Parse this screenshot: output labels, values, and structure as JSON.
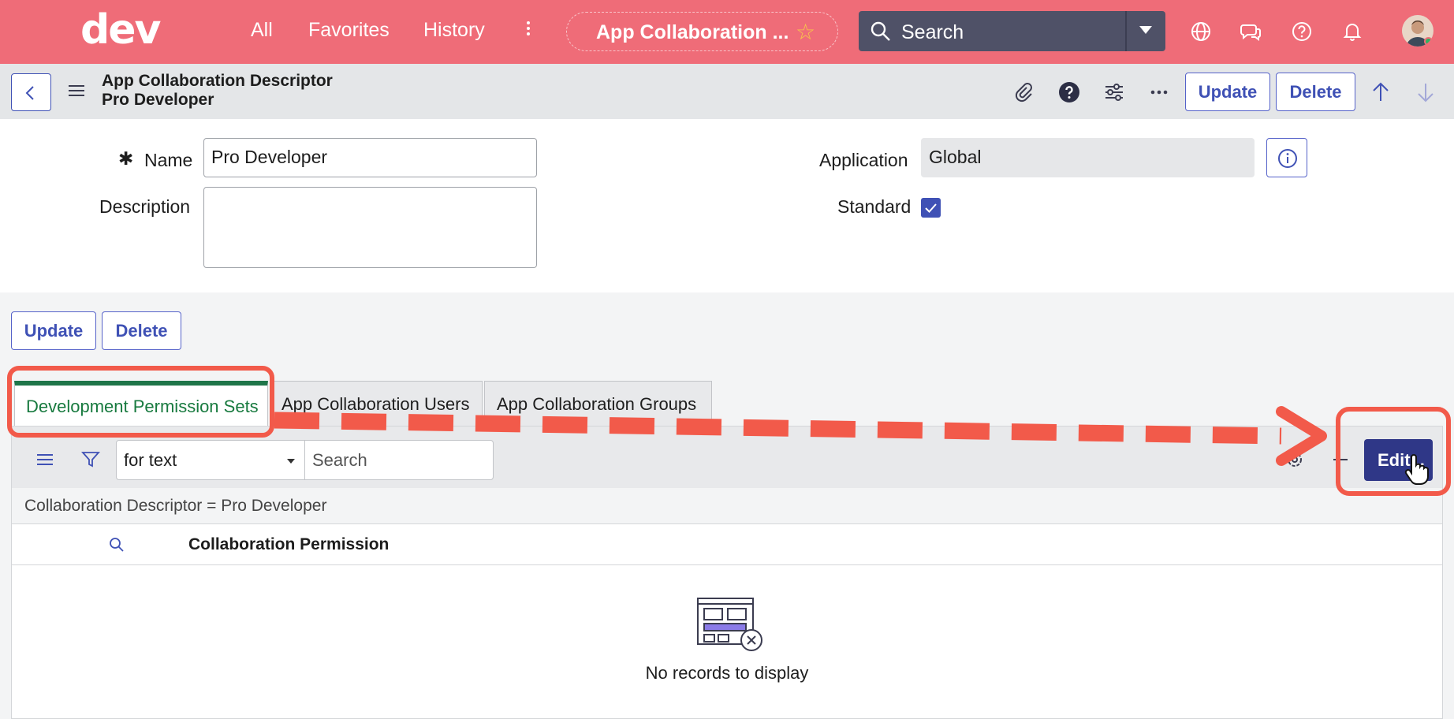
{
  "nav": {
    "logo": "dev",
    "links": [
      "All",
      "Favorites",
      "History"
    ],
    "context_title": "App Collaboration ...",
    "search_placeholder": "Search",
    "accent": "#ef6c78"
  },
  "header": {
    "record_line1": "App Collaboration Descriptor",
    "record_line2": "Pro Developer",
    "update_label": "Update",
    "delete_label": "Delete"
  },
  "form": {
    "name_label": "Name",
    "name_value": "Pro Developer",
    "description_label": "Description",
    "description_value": "",
    "application_label": "Application",
    "application_value": "Global",
    "standard_label": "Standard",
    "standard_checked": true
  },
  "form_buttons": {
    "update_label": "Update",
    "delete_label": "Delete"
  },
  "tabs": [
    {
      "label": "Development Permission Sets",
      "active": true
    },
    {
      "label": "App Collaboration Users",
      "active": false
    },
    {
      "label": "App Collaboration Groups",
      "active": false
    }
  ],
  "list": {
    "search_field_option": "for text",
    "search_placeholder": "Search",
    "edit_label": "Edit...",
    "filter_text": "Collaboration Descriptor = Pro Developer",
    "column_header": "Collaboration Permission",
    "empty_message": "No records to display"
  },
  "annotation_color": "#f25a4a"
}
